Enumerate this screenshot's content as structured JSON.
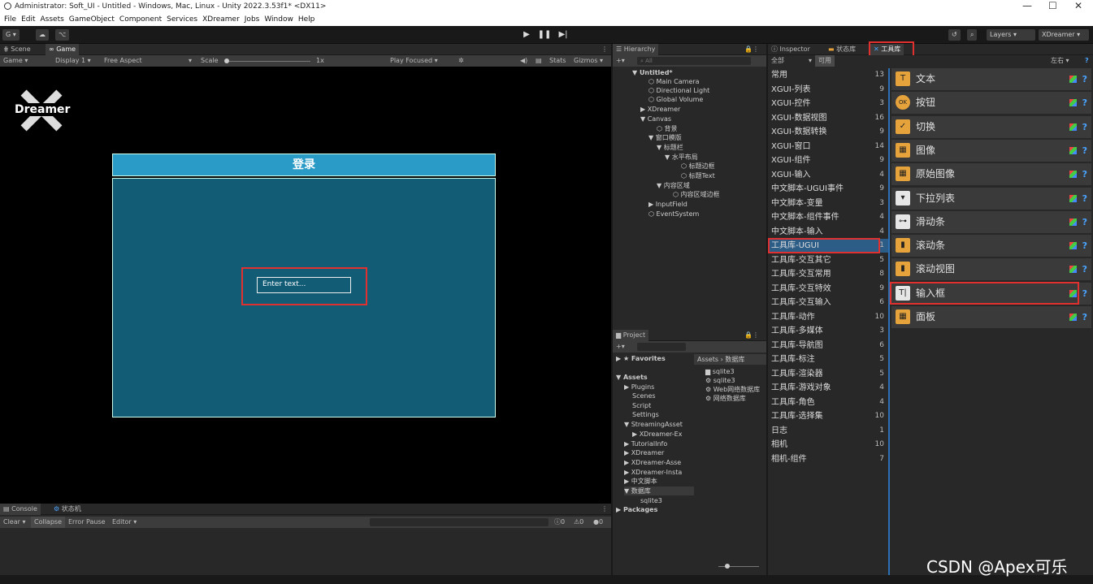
{
  "window": {
    "title": "Administrator: Soft_UI - Untitled - Windows, Mac, Linux - Unity 2022.3.53f1* <DX11>",
    "controls": [
      "—",
      "☐",
      "✕"
    ]
  },
  "menu": [
    "File",
    "Edit",
    "Assets",
    "GameObject",
    "Component",
    "Services",
    "XDreamer",
    "Jobs",
    "Window",
    "Help"
  ],
  "toolbar": {
    "account": "G ▾",
    "layers": "Layers",
    "layout": "XDreamer"
  },
  "scene_tabs": {
    "scene": "Scene",
    "game": "Game"
  },
  "game_bar": {
    "mode": "Game",
    "display": "Display 1",
    "aspect": "Free Aspect",
    "scale_label": "Scale",
    "scale_value": "1x",
    "play_focused": "Play Focused",
    "stats": "Stats",
    "gizmos": "Gizmos"
  },
  "game_view": {
    "logo": "Dreamer",
    "login_title": "登录",
    "input_placeholder": "Enter text..."
  },
  "console": {
    "tab": "Console",
    "tab2": "状态机",
    "clear": "Clear",
    "collapse": "Collapse",
    "error_pause": "Error Pause",
    "editor": "Editor",
    "counts": [
      "0",
      "0",
      "0"
    ]
  },
  "hierarchy": {
    "tab": "Hierarchy",
    "search": "All",
    "items": [
      {
        "label": "▼ Untitled*"
      },
      {
        "label": "Main Camera"
      },
      {
        "label": "Directional Light"
      },
      {
        "label": "Global Volume"
      },
      {
        "label": "▶ XDreamer"
      },
      {
        "label": "▼ Canvas"
      },
      {
        "label": "背景"
      },
      {
        "label": "▼ 窗口模版"
      },
      {
        "label": "▼ 标题栏"
      },
      {
        "label": "▼ 水平布局"
      },
      {
        "label": "标题边框"
      },
      {
        "label": "标题Text"
      },
      {
        "label": "▼ 内容区域"
      },
      {
        "label": "内容区域边框"
      },
      {
        "label": "▶ InputField"
      },
      {
        "label": "EventSystem"
      }
    ]
  },
  "project": {
    "tab": "Project",
    "favorites": "Favorites",
    "breadcrumb": "Assets › 数据库",
    "tree": [
      "▼ Assets",
      "▶ Plugins",
      "Scenes",
      "Script",
      "Settings",
      "▼ StreamingAsset",
      "▶ XDreamer-Ex",
      "▶ TutorialInfo",
      "▶ XDreamer",
      "▶ XDreamer-Asse",
      "▶ XDreamer-Insta",
      "▶ 中文脚本",
      "▼ 数据库",
      "sqlite3",
      "▶ Packages"
    ],
    "files": [
      "sqlite3",
      "sqlite3",
      "Web网络数据库",
      "网络数据库"
    ]
  },
  "inspector": {
    "tabs": [
      "Inspector",
      "状态库",
      "工具库"
    ],
    "filter": "全部",
    "filter2": "可用",
    "align": "左右 ▾",
    "categories": [
      [
        "常用",
        "13"
      ],
      [
        "XGUI-列表",
        "9"
      ],
      [
        "XGUI-控件",
        "3"
      ],
      [
        "XGUI-数据视图",
        "16"
      ],
      [
        "XGUI-数据转换",
        "9"
      ],
      [
        "XGUI-窗口",
        "14"
      ],
      [
        "XGUI-组件",
        "9"
      ],
      [
        "XGUI-输入",
        "4"
      ],
      [
        "中文脚本-UGUI事件",
        "9"
      ],
      [
        "中文脚本-变量",
        "3"
      ],
      [
        "中文脚本-组件事件",
        "4"
      ],
      [
        "中文脚本-输入",
        "4"
      ],
      [
        "工具库-UGUI",
        "1"
      ],
      [
        "工具库-交互其它",
        "5"
      ],
      [
        "工具库-交互常用",
        "8"
      ],
      [
        "工具库-交互特效",
        "9"
      ],
      [
        "工具库-交互输入",
        "6"
      ],
      [
        "工具库-动作",
        "10"
      ],
      [
        "工具库-多媒体",
        "3"
      ],
      [
        "工具库-导航图",
        "6"
      ],
      [
        "工具库-标注",
        "5"
      ],
      [
        "工具库-渲染器",
        "5"
      ],
      [
        "工具库-游戏对象",
        "4"
      ],
      [
        "工具库-角色",
        "4"
      ],
      [
        "工具库-选择集",
        "10"
      ],
      [
        "日志",
        "1"
      ],
      [
        "相机",
        "10"
      ],
      [
        "相机-组件",
        "7"
      ]
    ],
    "items": [
      {
        "label": "文本",
        "icon": "T"
      },
      {
        "label": "按钮",
        "icon": "OK"
      },
      {
        "label": "切换",
        "icon": "✓"
      },
      {
        "label": "图像",
        "icon": "▦"
      },
      {
        "label": "原始图像",
        "icon": "▦"
      },
      {
        "label": "下拉列表",
        "icon": "▾"
      },
      {
        "label": "滑动条",
        "icon": "⊶"
      },
      {
        "label": "滚动条",
        "icon": "▮"
      },
      {
        "label": "滚动视图",
        "icon": "▮"
      },
      {
        "label": "输入框",
        "icon": "T|"
      },
      {
        "label": "面板",
        "icon": "▦"
      }
    ]
  },
  "watermark": "CSDN @Apex可乐"
}
